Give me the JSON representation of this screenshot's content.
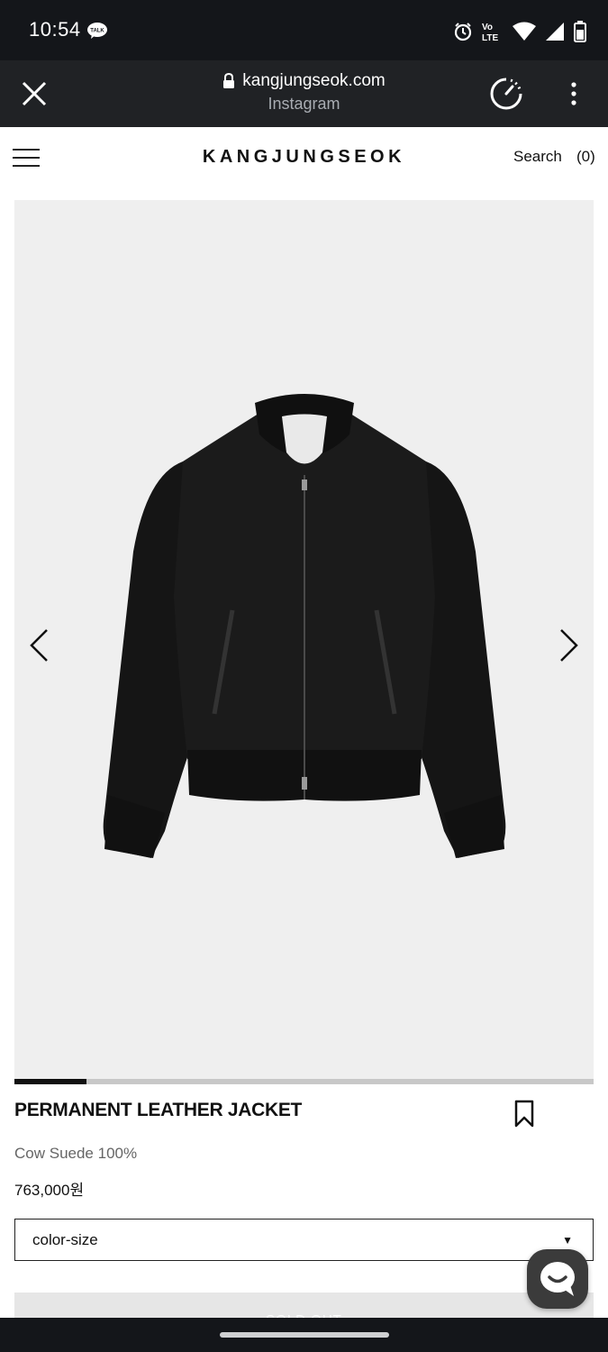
{
  "status_bar": {
    "time": "10:54",
    "icons": [
      "talk-icon",
      "alarm-icon",
      "volte-icon",
      "wifi-icon",
      "signal-icon",
      "battery-icon"
    ],
    "volte_label": "Vo LTE"
  },
  "browser": {
    "url": "kangjungseok.com",
    "source": "Instagram",
    "icons": [
      "close-icon",
      "lock-icon",
      "speed-icon",
      "more-vert-icon"
    ]
  },
  "header": {
    "logo": "KANGJUNGSEOK",
    "search_label": "Search",
    "cart_count": "(0)"
  },
  "gallery": {
    "image_subject": "black suede bomber jacket",
    "progress_fraction": 0.125,
    "background_color": "#efefef"
  },
  "product": {
    "title": "PERMANENT LEATHER JACKET",
    "material": "Cow Suede 100%",
    "price": "763,000원"
  },
  "option_select": {
    "selected": "color-size",
    "caret": "▼"
  },
  "soldout_button": {
    "label": "SOLD OUT"
  },
  "colors": {
    "status_bar_bg": "#14161a",
    "browser_bar_bg": "#202225",
    "accent": "#111111"
  }
}
